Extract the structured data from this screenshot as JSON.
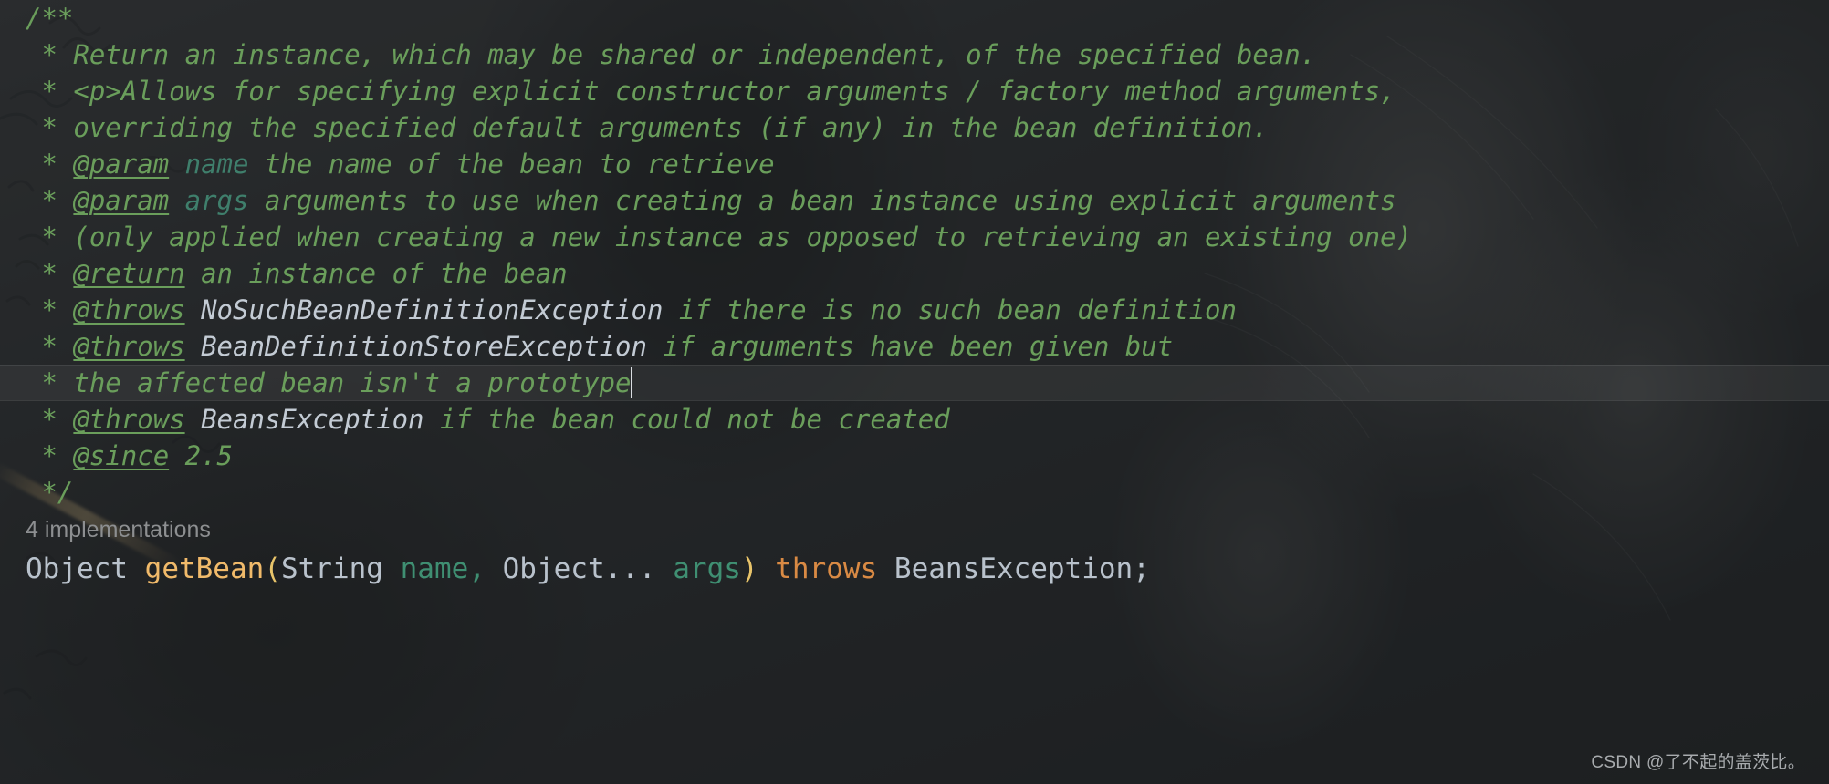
{
  "app": {
    "kind": "code-editor",
    "theme": "dark",
    "background_opacity_effect": true
  },
  "colors": {
    "editor_background": "#26282b",
    "javadoc_text": "#6a9e5b",
    "javadoc_tag": "#6a9e5b",
    "javadoc_param_name": "#3f7f6c",
    "javadoc_type": "#c3cbd4",
    "code_plain": "#b9c2cc",
    "code_method": "#f1ba6a",
    "code_paren": "#e8c46a",
    "code_identifier": "#3f8f72",
    "code_keyword": "#d98a44",
    "inlay_hint": "#8d8f91",
    "caret": "#d9dde1",
    "current_line_highlight": "rgba(255,255,255,0.055)"
  },
  "editor": {
    "lines": [
      {
        "id": "doc-open",
        "current": false,
        "tokens": [
          {
            "cls": "doc",
            "text": "/**"
          }
        ]
      },
      {
        "id": "doc-return-summary",
        "current": false,
        "tokens": [
          {
            "cls": "doc",
            "text": " * Return an instance, which may be shared or independent, of the specified bean."
          }
        ]
      },
      {
        "id": "doc-allows-p",
        "current": false,
        "tokens": [
          {
            "cls": "doc",
            "text": " * <p>Allows for specifying explicit constructor arguments / factory method arguments,"
          }
        ]
      },
      {
        "id": "doc-overriding",
        "current": false,
        "tokens": [
          {
            "cls": "doc",
            "text": " * overriding the specified default arguments (if any) in the bean definition."
          }
        ]
      },
      {
        "id": "doc-param-name",
        "current": false,
        "tokens": [
          {
            "cls": "doc",
            "text": " * "
          },
          {
            "cls": "doc-tag",
            "text": "@param"
          },
          {
            "cls": "doc",
            "text": " "
          },
          {
            "cls": "doc-param",
            "text": "name"
          },
          {
            "cls": "doc",
            "text": " the name of the bean to retrieve"
          }
        ]
      },
      {
        "id": "doc-param-args",
        "current": false,
        "tokens": [
          {
            "cls": "doc",
            "text": " * "
          },
          {
            "cls": "doc-tag",
            "text": "@param"
          },
          {
            "cls": "doc",
            "text": " "
          },
          {
            "cls": "doc-param",
            "text": "args"
          },
          {
            "cls": "doc",
            "text": " arguments to use when creating a bean instance using explicit arguments"
          }
        ]
      },
      {
        "id": "doc-only-applied",
        "current": false,
        "tokens": [
          {
            "cls": "doc",
            "text": " * (only applied when creating a new instance as opposed to retrieving an existing one)"
          }
        ]
      },
      {
        "id": "doc-return",
        "current": false,
        "tokens": [
          {
            "cls": "doc",
            "text": " * "
          },
          {
            "cls": "doc-tag",
            "text": "@return"
          },
          {
            "cls": "doc",
            "text": " an instance of the bean"
          }
        ]
      },
      {
        "id": "doc-throws-nosuchbean",
        "current": false,
        "tokens": [
          {
            "cls": "doc",
            "text": " * "
          },
          {
            "cls": "doc-tag",
            "text": "@throws"
          },
          {
            "cls": "doc",
            "text": " "
          },
          {
            "cls": "doc-type",
            "text": "NoSuchBeanDefinitionException"
          },
          {
            "cls": "doc",
            "text": " if there is no such bean definition"
          }
        ]
      },
      {
        "id": "doc-throws-beandefstore",
        "current": false,
        "tokens": [
          {
            "cls": "doc",
            "text": " * "
          },
          {
            "cls": "doc-tag",
            "text": "@throws"
          },
          {
            "cls": "doc",
            "text": " "
          },
          {
            "cls": "doc-type",
            "text": "BeanDefinitionStoreException"
          },
          {
            "cls": "doc",
            "text": " if arguments have been given but"
          }
        ]
      },
      {
        "id": "doc-prototype-continuation",
        "current": true,
        "caret_after": true,
        "tokens": [
          {
            "cls": "doc",
            "text": " * the affected bean isn't a prototype"
          }
        ]
      },
      {
        "id": "doc-throws-beansexception",
        "current": false,
        "tokens": [
          {
            "cls": "doc",
            "text": " * "
          },
          {
            "cls": "doc-tag",
            "text": "@throws"
          },
          {
            "cls": "doc",
            "text": " "
          },
          {
            "cls": "doc-type",
            "text": "BeansException"
          },
          {
            "cls": "doc",
            "text": " if the bean could not be created"
          }
        ]
      },
      {
        "id": "doc-since",
        "current": false,
        "tokens": [
          {
            "cls": "doc",
            "text": " * "
          },
          {
            "cls": "doc-tag",
            "text": "@since"
          },
          {
            "cls": "doc",
            "text": " 2.5"
          }
        ]
      },
      {
        "id": "doc-close",
        "current": false,
        "tokens": [
          {
            "cls": "doc",
            "text": " */"
          }
        ]
      }
    ],
    "implementations_hint": "4 implementations",
    "signature_tokens": [
      {
        "cls": "tok-plain",
        "text": "Object "
      },
      {
        "cls": "tok-method",
        "text": "getBean"
      },
      {
        "cls": "tok-paren",
        "text": "("
      },
      {
        "cls": "tok-plain",
        "text": "String "
      },
      {
        "cls": "tok-ident",
        "text": "name"
      },
      {
        "cls": "tok-comma",
        "text": ", "
      },
      {
        "cls": "tok-plain",
        "text": "Object... "
      },
      {
        "cls": "tok-ident",
        "text": "args"
      },
      {
        "cls": "tok-paren",
        "text": ")"
      },
      {
        "cls": "tok-plain",
        "text": " "
      },
      {
        "cls": "tok-kw",
        "text": "throws"
      },
      {
        "cls": "tok-plain",
        "text": " BeansException;"
      }
    ]
  },
  "watermark": {
    "text": "CSDN @了不起的盖茨比。"
  }
}
